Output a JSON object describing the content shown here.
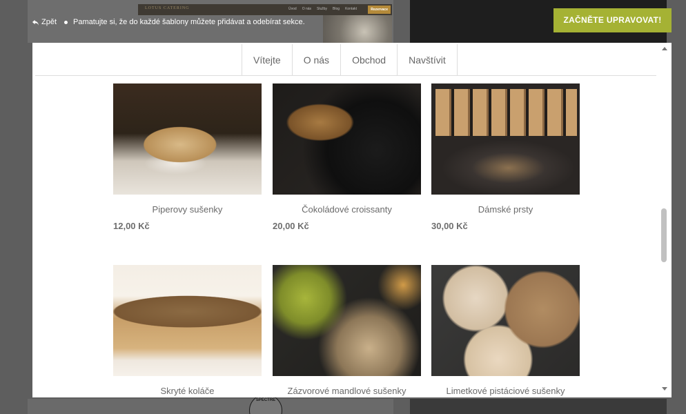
{
  "topbar": {
    "back_label": "Zpět",
    "notice": "Pamatujte si, že do každé šablony můžete přidávat a odebírat sekce.",
    "start_button": "ZAČNĚTE UPRAVOVAT!"
  },
  "tabs": [
    "Vítejte",
    "O nás",
    "Obchod",
    "Navštívit"
  ],
  "products": [
    {
      "name": "Piperovy sušenky",
      "price": "12,00 Kč",
      "image": "bread-photo"
    },
    {
      "name": "Čokoládové croissanty",
      "price": "20,00 Kč",
      "image": "croissant-photo"
    },
    {
      "name": "Dámské prsty",
      "price": "30,00 Kč",
      "image": "ladyfingers-photo"
    },
    {
      "name": "Skryté koláče",
      "price": "",
      "image": "cake-photo"
    },
    {
      "name": "Zázvorové mandlové sušenky",
      "price": "",
      "image": "ginger-cookies-photo"
    },
    {
      "name": "Limetkové pistáciové sušenky",
      "price": "",
      "image": "pistachio-cookies-photo"
    }
  ],
  "background": {
    "logo_text": "LOTUS CATERING",
    "nav_links": [
      "Úvod",
      "O nás",
      "Služby",
      "Blog",
      "Kontakt"
    ],
    "cta": "Rezervace",
    "badge_text": "SPECTRE"
  },
  "colors": {
    "accent": "#a5b234",
    "overlay": "#5e5e5e",
    "text_muted": "#6a6a6a"
  }
}
